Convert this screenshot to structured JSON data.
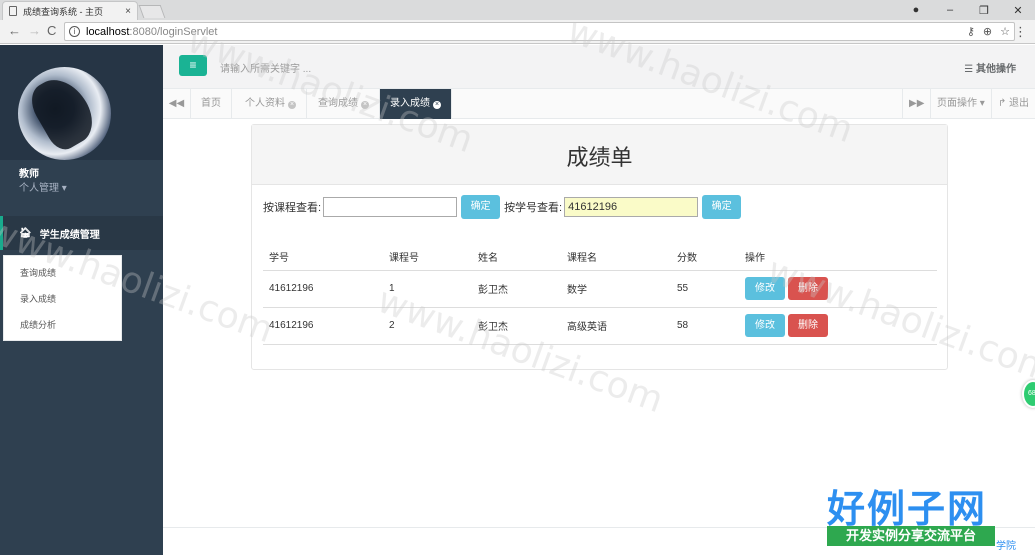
{
  "browser": {
    "tab_title": "成绩查询系统 - 主页",
    "tab_close": "×",
    "url_host": "localhost",
    "url_path": ":8080/loginServlet",
    "nav_back": "←",
    "nav_forward": "→",
    "nav_reload": "C",
    "win_min": "–",
    "win_max": "❐",
    "win_close": "✕",
    "menu": "⋮"
  },
  "sidebar": {
    "role": "教师",
    "user_menu": "个人管理 ▾",
    "section_label": "学生成绩管理",
    "items": [
      {
        "label": "查询成绩"
      },
      {
        "label": "录入成绩"
      },
      {
        "label": "成绩分析"
      }
    ]
  },
  "topbar": {
    "menu_icon": "≡",
    "search_placeholder": "请输入所需关键字 ...",
    "other_actions": "其他操作"
  },
  "content_tabs": {
    "prev": "◀◀",
    "tabs": [
      {
        "label": "首页"
      },
      {
        "label": "个人资料"
      },
      {
        "label": "查询成绩"
      },
      {
        "label": "录入成绩"
      }
    ],
    "next": "▶▶",
    "page_actions": "页面操作 ▾",
    "logout": "退出"
  },
  "panel": {
    "title": "成绩单",
    "course_filter_label": "按课程查看:",
    "course_filter_value": "",
    "confirm": "确定",
    "student_filter_label": "按学号查看:",
    "student_filter_value": "41612196",
    "columns": [
      "学号",
      "课程号",
      "姓名",
      "课程名",
      "分数",
      "操作"
    ],
    "rows": [
      {
        "student_id": "41612196",
        "course_no": "1",
        "name": "彭卫杰",
        "course_name": "数学",
        "score": "55"
      },
      {
        "student_id": "41612196",
        "course_no": "2",
        "name": "彭卫杰",
        "course_name": "高级英语",
        "score": "58"
      }
    ],
    "edit": "修改",
    "delete": "删除"
  },
  "overlay": {
    "brand": "好例子网",
    "brand_sub": "开发实例分享交流平台",
    "footer_partial": "学院",
    "bubble": "68"
  }
}
